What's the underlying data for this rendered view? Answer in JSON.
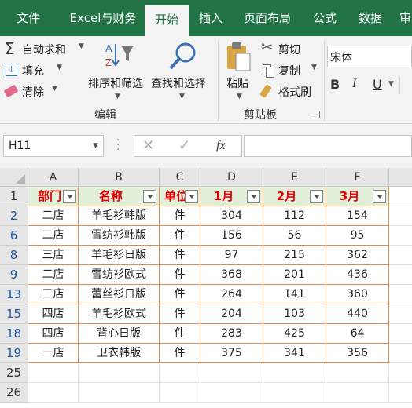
{
  "tabs": [
    "文件",
    "Excel与财务",
    "开始",
    "插入",
    "页面布局",
    "公式",
    "数据",
    "审"
  ],
  "active_tab": "开始",
  "ribbon": {
    "autosum": "自动求和",
    "fill": "填充",
    "clear": "清除",
    "sort_filter": "排序和筛选",
    "find_select": "查找和选择",
    "edit_group": "编辑",
    "paste": "粘贴",
    "cut": "剪切",
    "copy": "复制",
    "format_painter": "格式刷",
    "clipboard_group": "剪贴板",
    "font_name": "宋体",
    "bold": "B",
    "italic": "I",
    "underline": "U"
  },
  "formula_bar": {
    "name_box": "H11",
    "fx": "fx",
    "formula": ""
  },
  "columns": [
    "A",
    "B",
    "C",
    "D",
    "E",
    "F"
  ],
  "header_row": {
    "row_num": "1",
    "cells": [
      "部门",
      "名称",
      "单位",
      "1月",
      "2月",
      "3月"
    ]
  },
  "rows": [
    {
      "row_num": "2",
      "cells": [
        "二店",
        "羊毛衫韩版",
        "件",
        "304",
        "112",
        "154"
      ]
    },
    {
      "row_num": "6",
      "cells": [
        "二店",
        "雪纺衫韩版",
        "件",
        "156",
        "56",
        "95"
      ]
    },
    {
      "row_num": "8",
      "cells": [
        "三店",
        "羊毛衫日版",
        "件",
        "97",
        "215",
        "362"
      ]
    },
    {
      "row_num": "9",
      "cells": [
        "二店",
        "雪纺衫欧式",
        "件",
        "368",
        "201",
        "436"
      ]
    },
    {
      "row_num": "13",
      "cells": [
        "三店",
        "蕾丝衫日版",
        "件",
        "264",
        "141",
        "360"
      ]
    },
    {
      "row_num": "15",
      "cells": [
        "四店",
        "羊毛衫欧式",
        "件",
        "204",
        "103",
        "440"
      ]
    },
    {
      "row_num": "18",
      "cells": [
        "四店",
        "背心日版",
        "件",
        "283",
        "425",
        "64"
      ]
    },
    {
      "row_num": "19",
      "cells": [
        "一店",
        "卫衣韩版",
        "件",
        "375",
        "341",
        "356"
      ]
    }
  ],
  "empty_rows": [
    "25",
    "26"
  ],
  "colors": {
    "accent": "#217346",
    "header_fill": "#e2efda",
    "header_text": "#e60000",
    "border": "#e08a4c",
    "filtered_row_num": "#1f5aa6"
  }
}
